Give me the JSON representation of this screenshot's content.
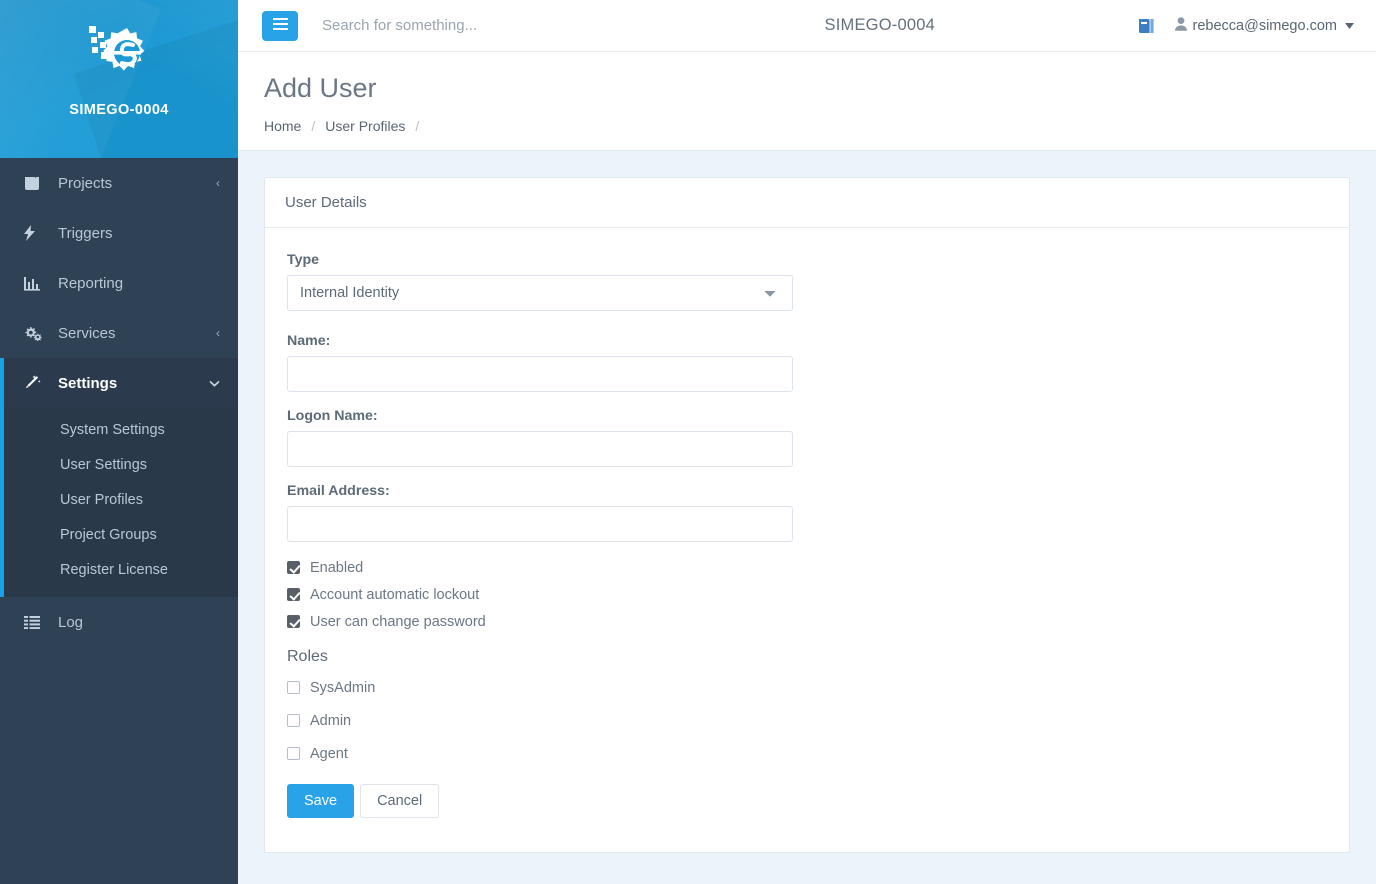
{
  "brand": {
    "logo_icon": "simego-gear-logo",
    "name": "SIMEGO-0004"
  },
  "topbar": {
    "menu_icon": "hamburger-menu-icon",
    "search_placeholder": "Search for something...",
    "search_value": "",
    "title": "SIMEGO-0004",
    "book_icon": "book-icon",
    "user_icon": "user-icon",
    "user_email": "rebecca@simego.com",
    "caret_icon": "caret-down-icon"
  },
  "page": {
    "title": "Add User",
    "breadcrumb": [
      {
        "label": "Home",
        "sep": "/"
      },
      {
        "label": "User Profiles",
        "sep": "/"
      }
    ]
  },
  "sidebar": {
    "items": [
      {
        "label": "Projects",
        "icon": "book-icon",
        "caret": "‹",
        "active": false
      },
      {
        "label": "Triggers",
        "icon": "bolt-icon",
        "caret": "",
        "active": false
      },
      {
        "label": "Reporting",
        "icon": "bar-chart-icon",
        "caret": "",
        "active": false
      },
      {
        "label": "Services",
        "icon": "gears-icon",
        "caret": "‹",
        "active": false
      },
      {
        "label": "Settings",
        "icon": "magic-wand-icon",
        "caret": "⌄",
        "active": true
      }
    ],
    "submenu": [
      {
        "label": "System Settings"
      },
      {
        "label": "User Settings"
      },
      {
        "label": "User Profiles"
      },
      {
        "label": "Project Groups"
      },
      {
        "label": "Register License"
      }
    ],
    "footer_items": [
      {
        "label": "Log",
        "icon": "list-icon"
      }
    ]
  },
  "form": {
    "card_title": "User Details",
    "type_label": "Type",
    "type_value": "Internal Identity",
    "type_options": [
      "Internal Identity"
    ],
    "fields": [
      {
        "label": "Name:",
        "value": "",
        "placeholder": ""
      },
      {
        "label": "Logon Name:",
        "value": "",
        "placeholder": ""
      },
      {
        "label": "Email Address:",
        "value": "",
        "placeholder": ""
      }
    ],
    "options": [
      {
        "label": "Enabled",
        "checked": true
      },
      {
        "label": "Account automatic lockout",
        "checked": true
      },
      {
        "label": "User can change password",
        "checked": true
      }
    ],
    "roles_title": "Roles",
    "roles": [
      {
        "label": "SysAdmin",
        "checked": false
      },
      {
        "label": "Admin",
        "checked": false
      },
      {
        "label": "Agent",
        "checked": false
      }
    ],
    "save_label": "Save",
    "cancel_label": "Cancel"
  },
  "colors": {
    "accent": "#29a3e8",
    "sidebar": "#2f4154",
    "submenu": "#2a3949",
    "page_bg": "#edf3fb"
  }
}
